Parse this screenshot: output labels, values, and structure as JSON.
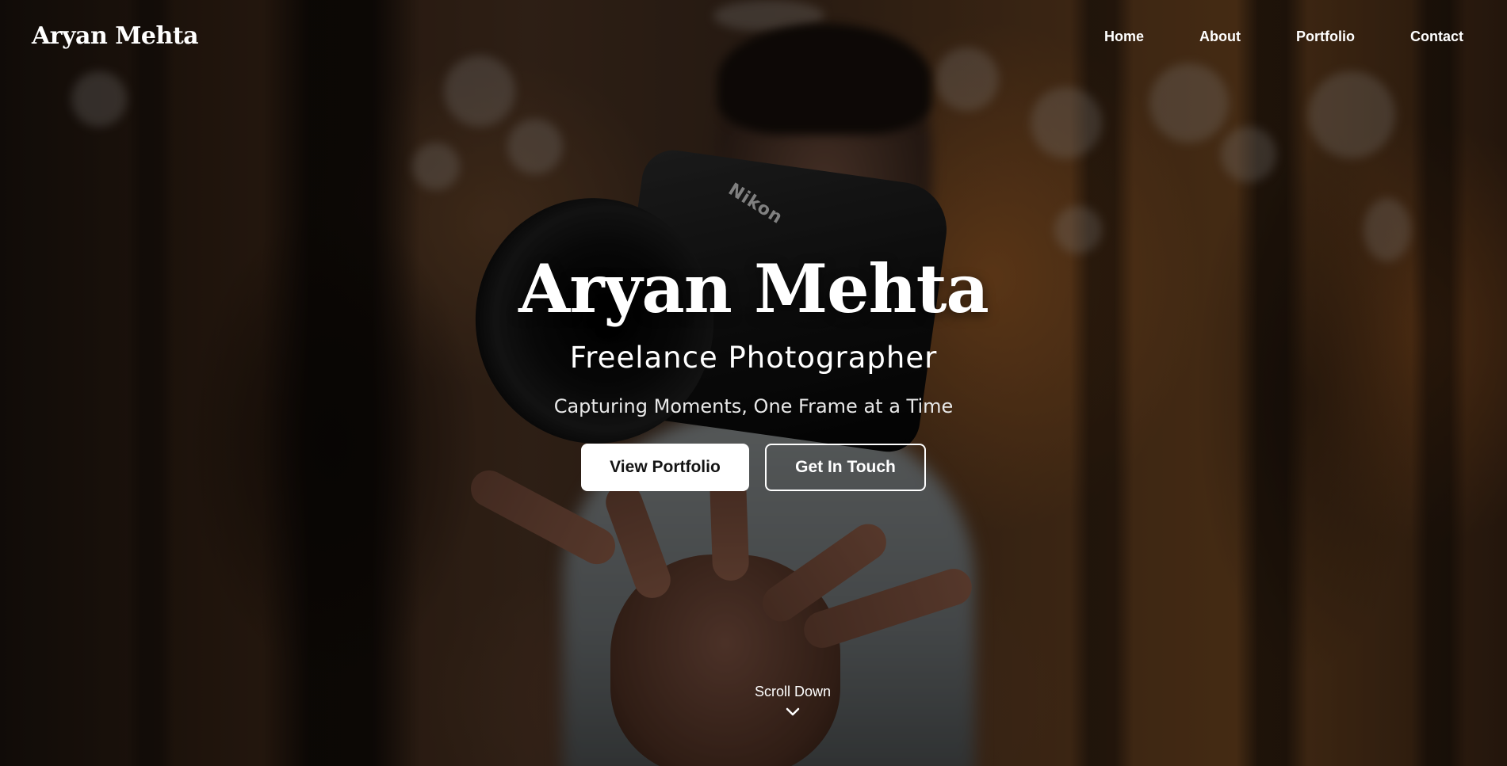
{
  "header": {
    "logo": "Aryan Mehta",
    "nav": [
      {
        "label": "Home"
      },
      {
        "label": "About"
      },
      {
        "label": "Portfolio"
      },
      {
        "label": "Contact"
      }
    ]
  },
  "hero": {
    "title": "Aryan Mehta",
    "subtitle": "Freelance Photographer",
    "tagline": "Capturing Moments, One Frame at a Time",
    "buttons": {
      "primary": "View Portfolio",
      "secondary": "Get In Touch"
    },
    "background_camera_brand": "Nikon"
  },
  "scroll": {
    "label": "Scroll Down",
    "icon": "chevron-down-icon"
  },
  "colors": {
    "text": "#ffffff",
    "primary_button_bg": "#ffffff",
    "primary_button_text": "#141414",
    "overlay": "rgba(0,0,0,0.38)"
  }
}
